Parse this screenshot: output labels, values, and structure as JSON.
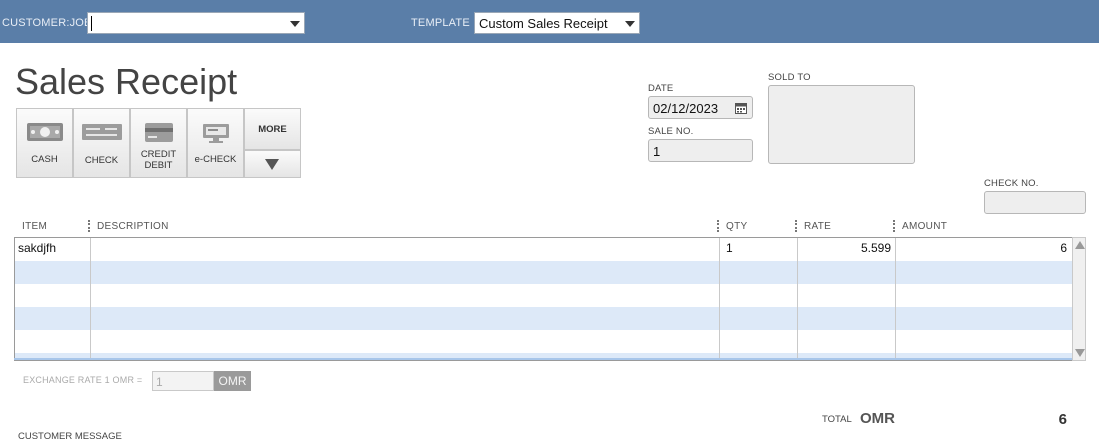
{
  "header": {
    "customer_job_label": "CUSTOMER:JOB",
    "customer_job_value": "",
    "template_label": "TEMPLATE",
    "template_value": "Custom Sales Receipt"
  },
  "form": {
    "title": "Sales Receipt",
    "date_label": "DATE",
    "date_value": "02/12/2023",
    "sale_no_label": "SALE NO.",
    "sale_no_value": "1",
    "sold_to_label": "SOLD TO",
    "sold_to_value": "",
    "check_no_label": "CHECK NO.",
    "check_no_value": ""
  },
  "payment_buttons": [
    {
      "label": "CASH",
      "icon": "cash-icon"
    },
    {
      "label": "CHECK",
      "icon": "check-icon"
    },
    {
      "label_line1": "CREDIT",
      "label_line2": "DEBIT",
      "icon": "credit-card-icon"
    },
    {
      "label": "e-CHECK",
      "icon": "echeck-icon"
    },
    {
      "label": "MORE",
      "icon": "chevron-down-icon"
    }
  ],
  "table": {
    "columns": [
      "ITEM",
      "DESCRIPTION",
      "QTY",
      "RATE",
      "AMOUNT"
    ],
    "rows": [
      {
        "item": "sakdjfh",
        "description": "",
        "qty": "1",
        "rate": "5.599",
        "amount": "6"
      }
    ]
  },
  "exchange": {
    "label": "EXCHANGE RATE 1 OMR =",
    "value": "1",
    "currency": "OMR"
  },
  "totals": {
    "total_label": "TOTAL",
    "currency": "OMR",
    "amount": "6"
  },
  "customer_message_label": "CUSTOMER MESSAGE",
  "colors": {
    "header_bg": "#5a7ea8",
    "alt_row": "#dde9f8"
  }
}
